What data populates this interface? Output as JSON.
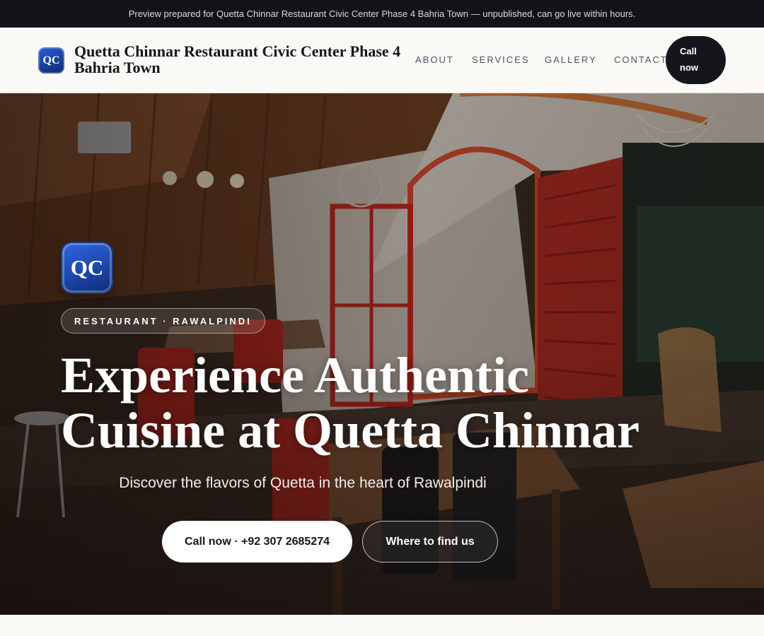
{
  "preview_bar": {
    "text": "Preview prepared for Quetta Chinnar Restaurant Civic Center Phase 4 Bahria Town — unpublished, can go live within hours."
  },
  "header": {
    "logo_text": "QC",
    "business_name": "Quetta Chinnar Restaurant Civic Center Phase 4 Bahria Town",
    "nav": {
      "about": "ABOUT",
      "services": "SERVICES",
      "gallery": "GALLERY",
      "contact": "CONTACT"
    },
    "call_button": "Call now"
  },
  "hero": {
    "logo_text": "QC",
    "tag": "RESTAURANT · RAWALPINDI",
    "title": "Experience Authentic Cuisine at Quetta Chinnar",
    "subtitle": "Discover the flavors of Quetta in the heart of Rawalpindi",
    "primary_button": "Call now · +92 307 2685274",
    "secondary_button": "Where to find us",
    "photo_icon": "restaurant-interior-photo"
  },
  "colors": {
    "dark": "#14161b",
    "accent_blue": "#1f4cc0",
    "background": "#faf9f6"
  }
}
